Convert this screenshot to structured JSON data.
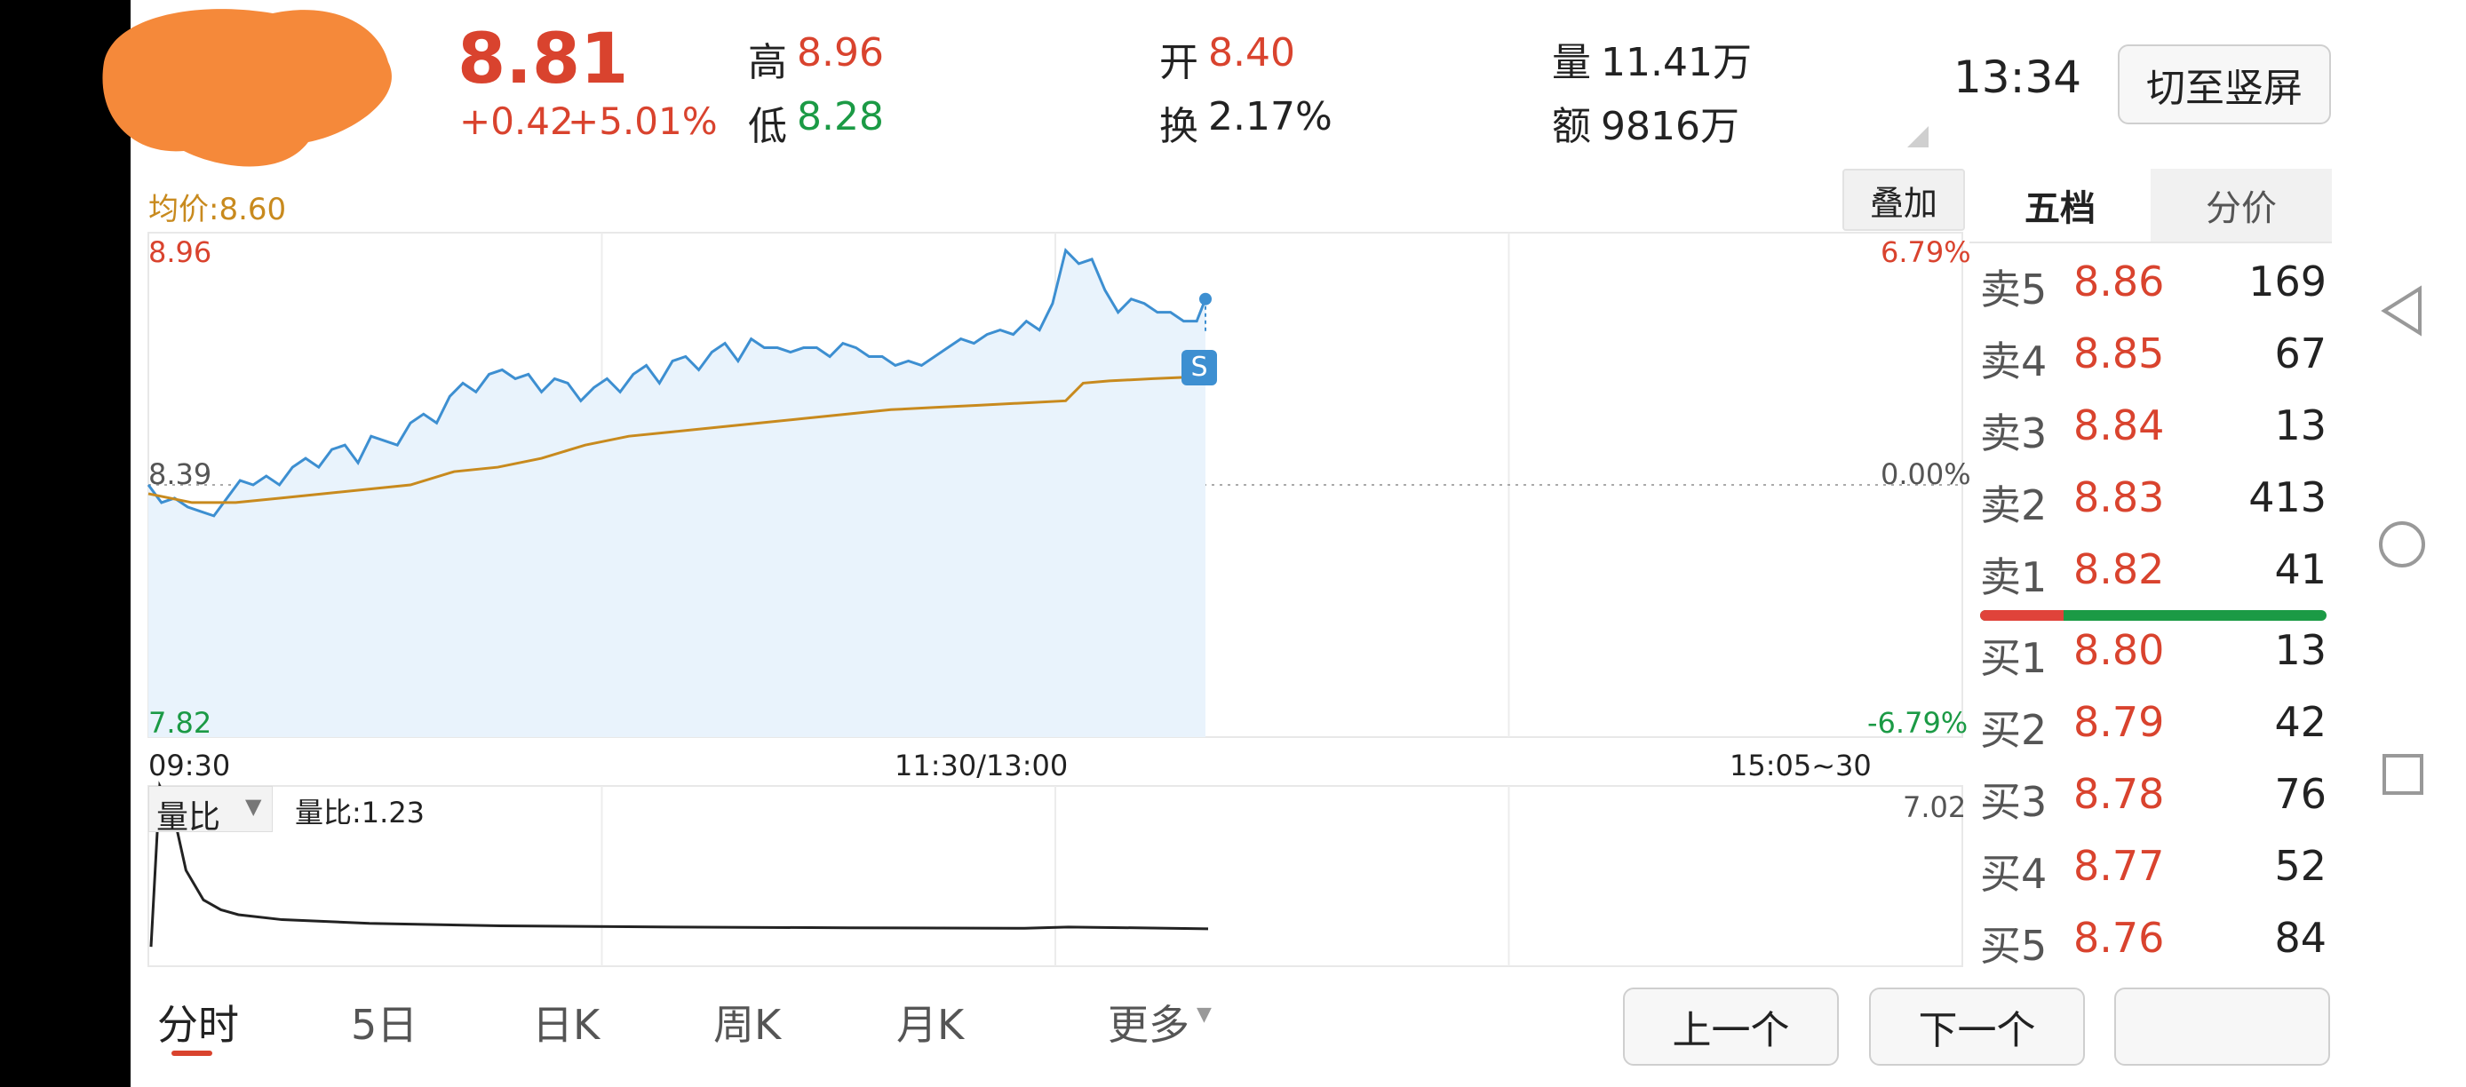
{
  "header": {
    "price": "8.81",
    "change": "+0.42",
    "change_pct": "+5.01%",
    "high_label": "高",
    "high": "8.96",
    "low_label": "低",
    "low": "8.28",
    "open_label": "开",
    "open": "8.40",
    "turnover_label": "换",
    "turnover": "2.17%",
    "volume_label": "量",
    "volume": "11.41万",
    "amount_label": "额",
    "amount": "9816万",
    "time": "13:34",
    "switch_label": "切至竖屏"
  },
  "chart": {
    "avg_label": "均价:8.60",
    "overlay_label": "叠加",
    "y_max": "8.96",
    "y_mid": "8.39",
    "y_min": "7.82",
    "pct_max": "6.79%",
    "pct_mid": "0.00%",
    "pct_min": "-6.79%",
    "x_start": "09:30",
    "x_mid": "11:30/13:00",
    "x_end": "15:05~30",
    "marker": "S",
    "vol_label": "量比",
    "vol_value": "量比:1.23",
    "vol_max": "7.02"
  },
  "chart_data": {
    "type": "line",
    "title": "",
    "x_domain": [
      0,
      242
    ],
    "ylim": [
      7.82,
      8.96
    ],
    "base": 8.39,
    "series": [
      {
        "name": "",
        "x": [
          0,
          3,
          6,
          9,
          12,
          15,
          18,
          21,
          24,
          27,
          30,
          33,
          36,
          39,
          42,
          45,
          48,
          51,
          54,
          57,
          60,
          63,
          66,
          69,
          72,
          75,
          78,
          81,
          84,
          87,
          90,
          93,
          96,
          99,
          102,
          105,
          108,
          111,
          114,
          117,
          120,
          123,
          126,
          129,
          132,
          135,
          138,
          141,
          144,
          147,
          150,
          153,
          156,
          159,
          162,
          165,
          168,
          171,
          174,
          177,
          180,
          183,
          186,
          189,
          192,
          195,
          198,
          201,
          204,
          207,
          210,
          213,
          216,
          219,
          222,
          225,
          228,
          231,
          234,
          237,
          240,
          242
        ],
        "values": [
          8.39,
          8.35,
          8.36,
          8.34,
          8.33,
          8.32,
          8.36,
          8.4,
          8.39,
          8.41,
          8.39,
          8.43,
          8.45,
          8.43,
          8.47,
          8.48,
          8.44,
          8.5,
          8.49,
          8.48,
          8.53,
          8.55,
          8.53,
          8.59,
          8.62,
          8.6,
          8.64,
          8.65,
          8.63,
          8.64,
          8.6,
          8.63,
          8.62,
          8.58,
          8.61,
          8.63,
          8.6,
          8.64,
          8.66,
          8.62,
          8.67,
          8.68,
          8.65,
          8.69,
          8.71,
          8.67,
          8.72,
          8.7,
          8.7,
          8.69,
          8.7,
          8.7,
          8.68,
          8.71,
          8.7,
          8.68,
          8.68,
          8.66,
          8.67,
          8.66,
          8.68,
          8.7,
          8.72,
          8.71,
          8.73,
          8.74,
          8.73,
          8.76,
          8.74,
          8.8,
          8.92,
          8.89,
          8.9,
          8.83,
          8.78,
          8.81,
          8.8,
          8.78,
          8.78,
          8.76,
          8.76,
          8.81
        ]
      },
      {
        "name": "",
        "x": [
          0,
          10,
          20,
          30,
          40,
          50,
          60,
          70,
          80,
          90,
          100,
          110,
          120,
          130,
          140,
          150,
          160,
          170,
          180,
          190,
          200,
          210,
          214,
          220,
          230,
          242
        ],
        "values": [
          8.37,
          8.35,
          8.35,
          8.36,
          8.37,
          8.38,
          8.39,
          8.42,
          8.43,
          8.45,
          8.48,
          8.5,
          8.51,
          8.52,
          8.53,
          8.54,
          8.55,
          8.56,
          8.565,
          8.57,
          8.575,
          8.58,
          8.62,
          8.625,
          8.63,
          8.635
        ]
      }
    ],
    "volume_ratio": {
      "ylim": [
        0,
        7.02
      ],
      "x": [
        0,
        2,
        4,
        6,
        8,
        12,
        16,
        20,
        30,
        50,
        80,
        120,
        160,
        200,
        210,
        220,
        242
      ],
      "values": [
        0.5,
        7.02,
        6.3,
        5.2,
        3.6,
        2.4,
        2.0,
        1.8,
        1.6,
        1.45,
        1.35,
        1.3,
        1.27,
        1.25,
        1.3,
        1.28,
        1.23
      ]
    }
  },
  "orderbook": {
    "tab_active": "五档",
    "tab_other": "分价",
    "asks": [
      {
        "label": "卖5",
        "price": "8.86",
        "vol": "169"
      },
      {
        "label": "卖4",
        "price": "8.85",
        "vol": "67"
      },
      {
        "label": "卖3",
        "price": "8.84",
        "vol": "13"
      },
      {
        "label": "卖2",
        "price": "8.83",
        "vol": "413"
      },
      {
        "label": "卖1",
        "price": "8.82",
        "vol": "41"
      }
    ],
    "bids": [
      {
        "label": "买1",
        "price": "8.80",
        "vol": "13"
      },
      {
        "label": "买2",
        "price": "8.79",
        "vol": "42"
      },
      {
        "label": "买3",
        "price": "8.78",
        "vol": "76"
      },
      {
        "label": "买4",
        "price": "8.77",
        "vol": "52"
      },
      {
        "label": "买5",
        "price": "8.76",
        "vol": "84"
      }
    ],
    "buy_ratio": 0.24
  },
  "tabs": [
    "分时",
    "5日",
    "日K",
    "周K",
    "月K",
    "更多"
  ],
  "nav": {
    "prev": "上一个",
    "next": "下一个"
  },
  "colors": {
    "up": "#d9432e",
    "down": "#1b9a45",
    "price_line": "#3d8fd1",
    "avg_line": "#c88a1e",
    "area": "#e9f3fc"
  }
}
